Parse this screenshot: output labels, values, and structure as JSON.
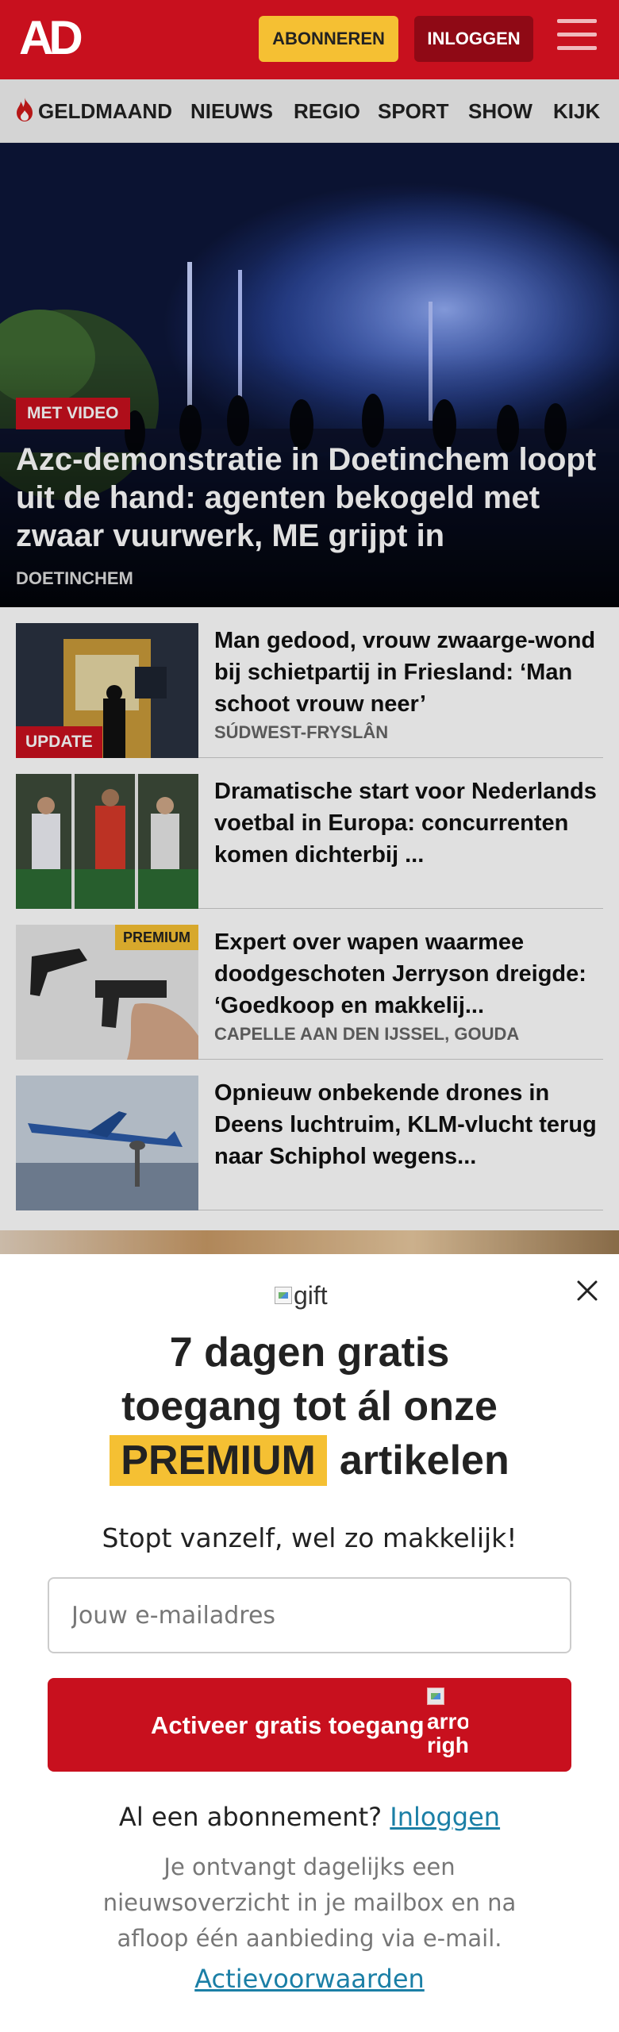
{
  "header": {
    "logo": "AD",
    "subscribe_label": "ABONNEREN",
    "login_label": "INLOGGEN",
    "brand_color": "#c8101e",
    "accent_color": "#f5c033"
  },
  "nav": {
    "items": [
      "GELDMAAND",
      "NIEUWS",
      "REGIO",
      "SPORT",
      "SHOW",
      "KIJK"
    ]
  },
  "hero": {
    "badge": "MET VIDEO",
    "title": "Azc-demonstratie in Doetinchem loopt uit de hand: agenten bekogeld met zwaar vuurwerk, ME grijpt in",
    "location": "DOETINCHEM"
  },
  "articles": [
    {
      "badge": "UPDATE",
      "title": "Man gedood, vrouw zwaarge-wond bij schietpartij in Friesland: ‘Man schoot vrouw neer’",
      "location": "SÚDWEST-FRYSLÂN"
    },
    {
      "title": "Dramatische start voor Nederlands voetbal in Europa: concurrenten komen dichterbij ..."
    },
    {
      "badge": "PREMIUM",
      "title": "Expert over wapen waarmee doodgeschoten Jerryson dreigde: ‘Goedkoop en makkelij...",
      "location": "CAPELLE AAN DEN IJSSEL, GOUDA"
    },
    {
      "title": "Opnieuw onbekende drones in Deens luchtruim, KLM-vlucht terug naar Schiphol wegens..."
    }
  ],
  "modal": {
    "gift_alt": "gift",
    "headline_line1": "7 dagen gratis",
    "headline_line2": "toegang tot ál onze",
    "headline_premium": "PREMIUM",
    "headline_end": "artikelen",
    "subtitle": "Stopt vanzelf, wel zo makkelijk!",
    "email_placeholder": "Jouw e-mailadres",
    "email_value": "",
    "activate_label": "Activeer gratis toegang",
    "arrow_alt": "arrow right",
    "already_text": "Al een abonnement?",
    "already_link": "Inloggen",
    "info": "Je ontvangt dagelijks een nieuwsoverzicht in je mailbox en na afloop één aanbieding via e-mail.",
    "terms": "Actievoorwaarden"
  }
}
